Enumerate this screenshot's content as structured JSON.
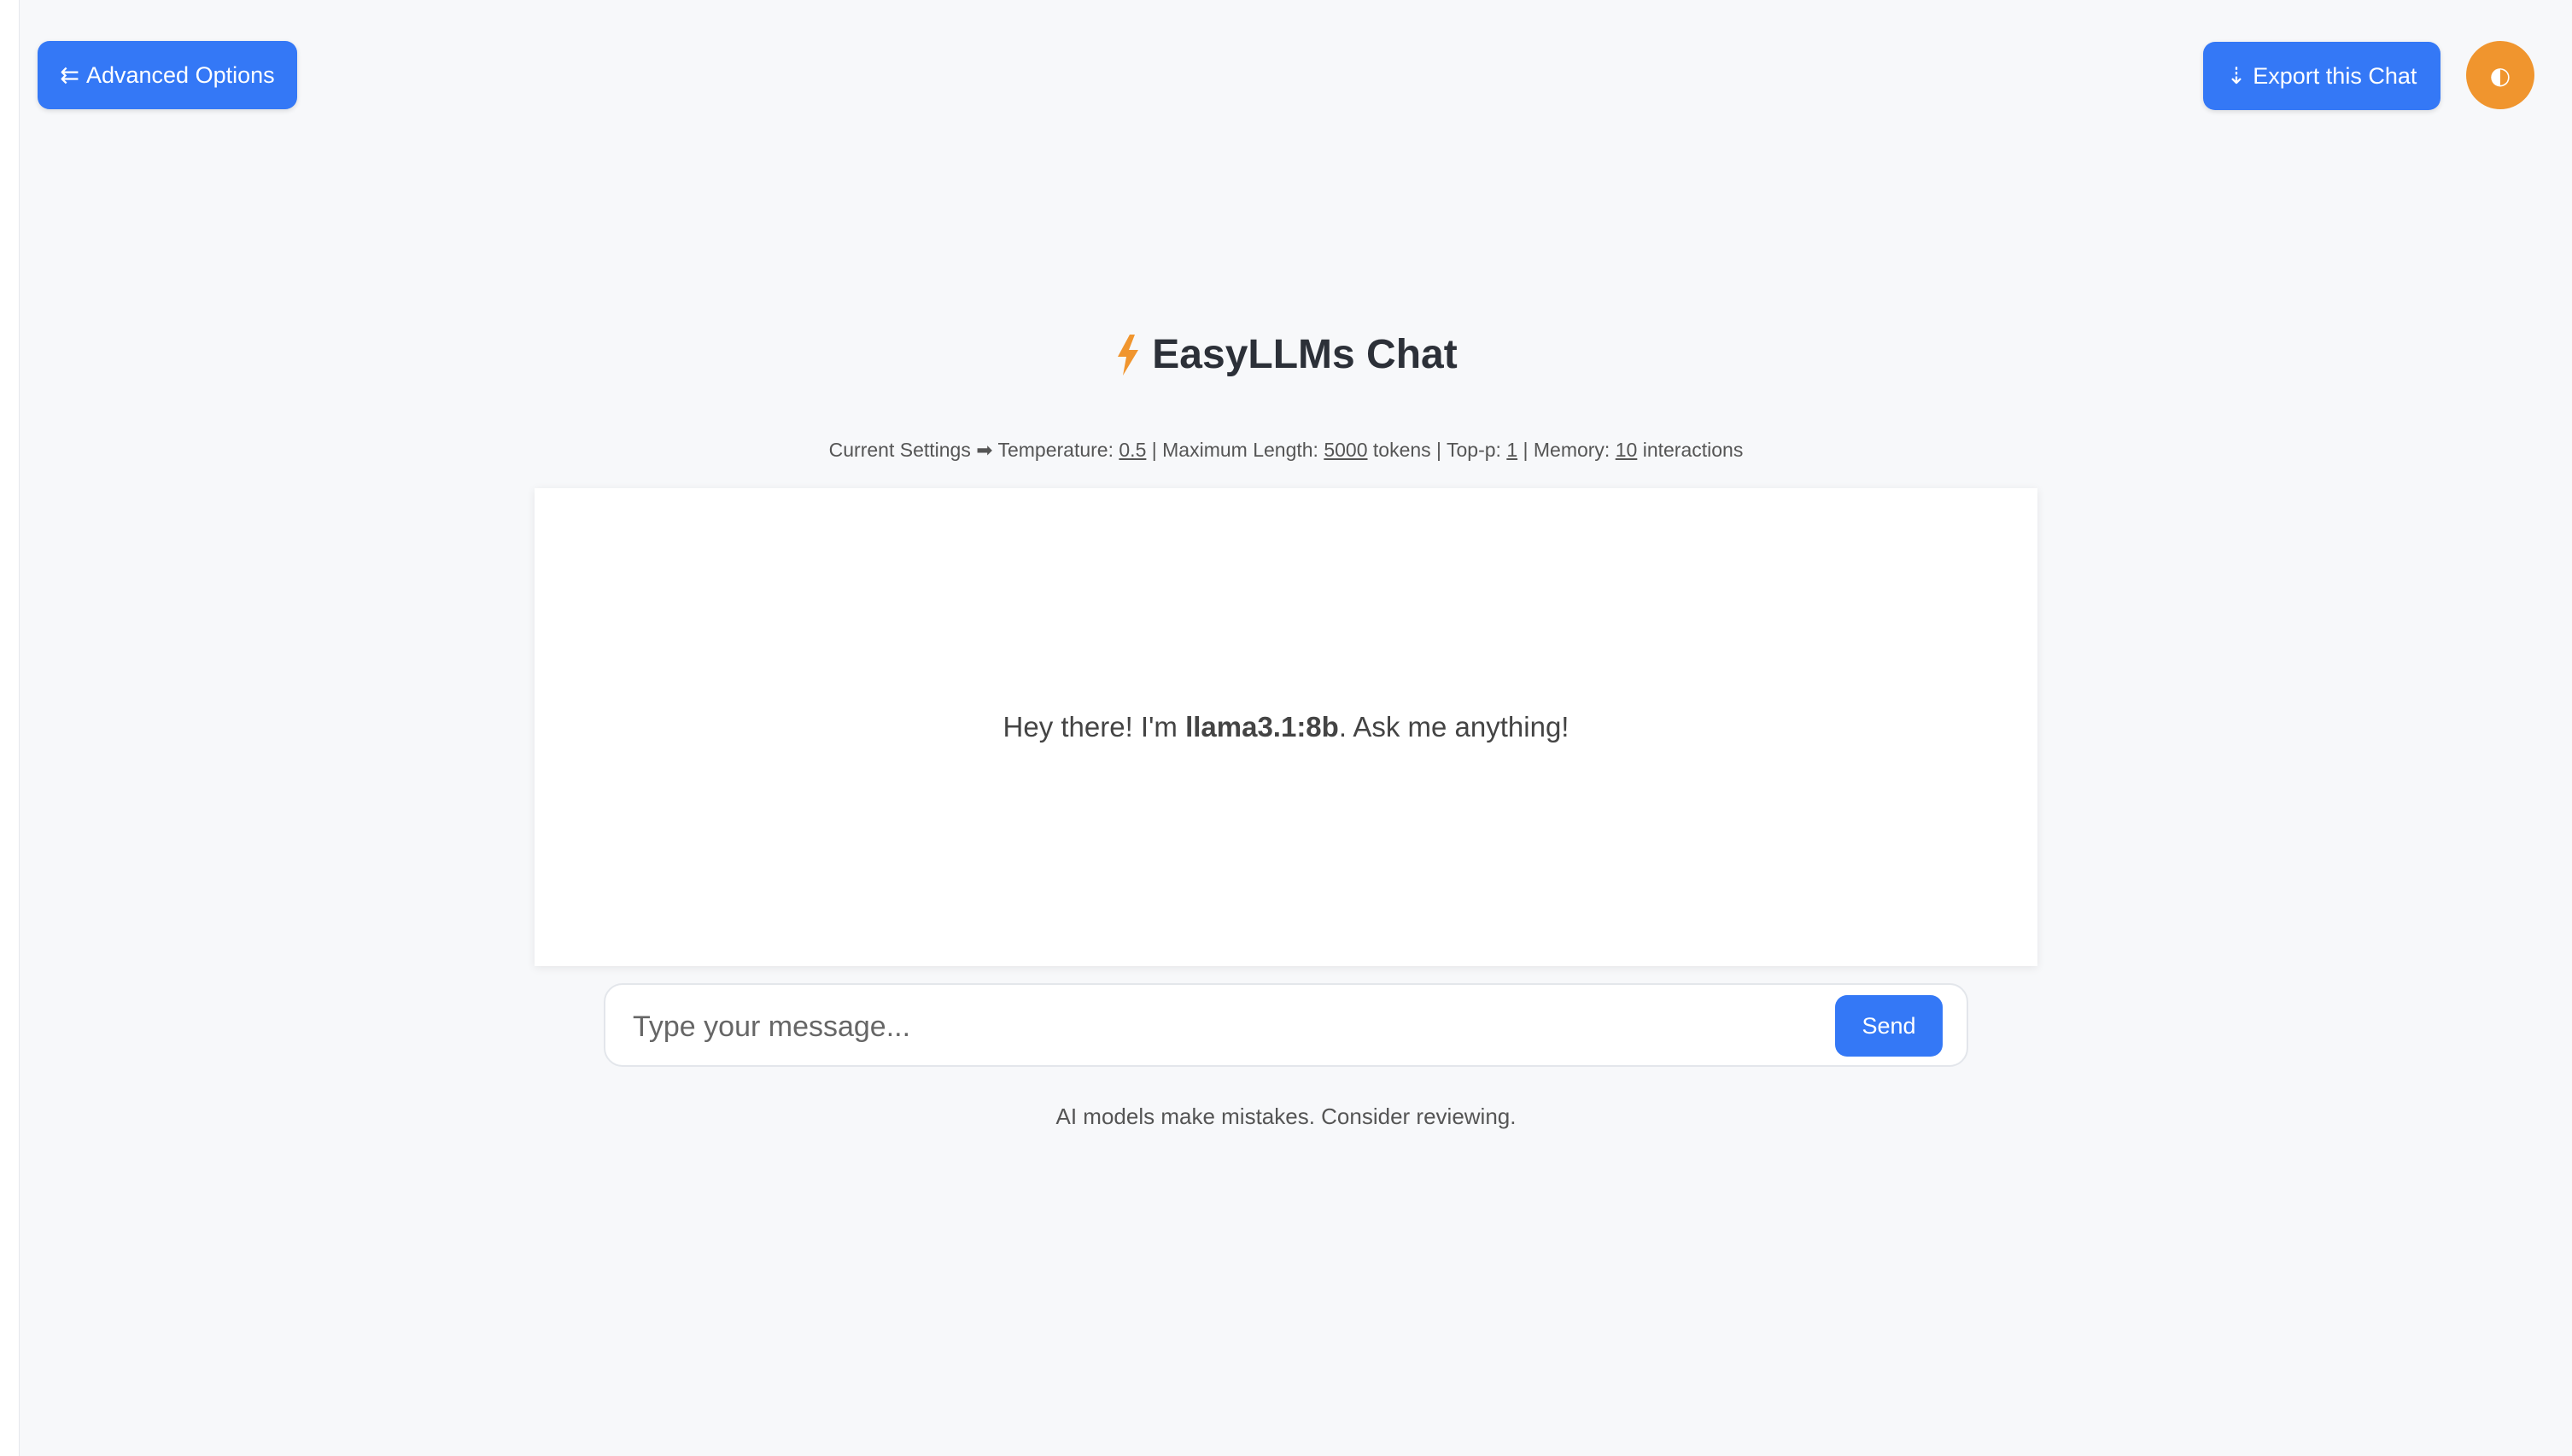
{
  "header": {
    "advanced_options_label": "Advanced Options",
    "advanced_options_glyph": "⇇",
    "export_label": "Export this Chat",
    "export_glyph": "⇣",
    "theme_toggle_glyph": "◐"
  },
  "app": {
    "title": "EasyLLMs Chat",
    "icon": "lightning-bolt-icon"
  },
  "settings": {
    "prefix": "Current Settings ➡ Temperature:",
    "temperature": "0.5",
    "max_length_label": "| Maximum Length:",
    "max_length": "5000",
    "tokens_label": "tokens | Top-p:",
    "top_p": "1",
    "memory_label": "| Memory:",
    "memory": "10",
    "interactions_label": "interactions"
  },
  "chat": {
    "greeting_before": "Hey there! I'm ",
    "model_name": "llama3.1:8b",
    "greeting_after": ". Ask me anything!"
  },
  "input": {
    "placeholder": "Type your message...",
    "send_label": "Send"
  },
  "footer": {
    "disclaimer": "AI models make mistakes. Consider reviewing."
  },
  "colors": {
    "primary": "#3478f6",
    "accent": "#f0952e",
    "background": "#f7f8fa"
  }
}
